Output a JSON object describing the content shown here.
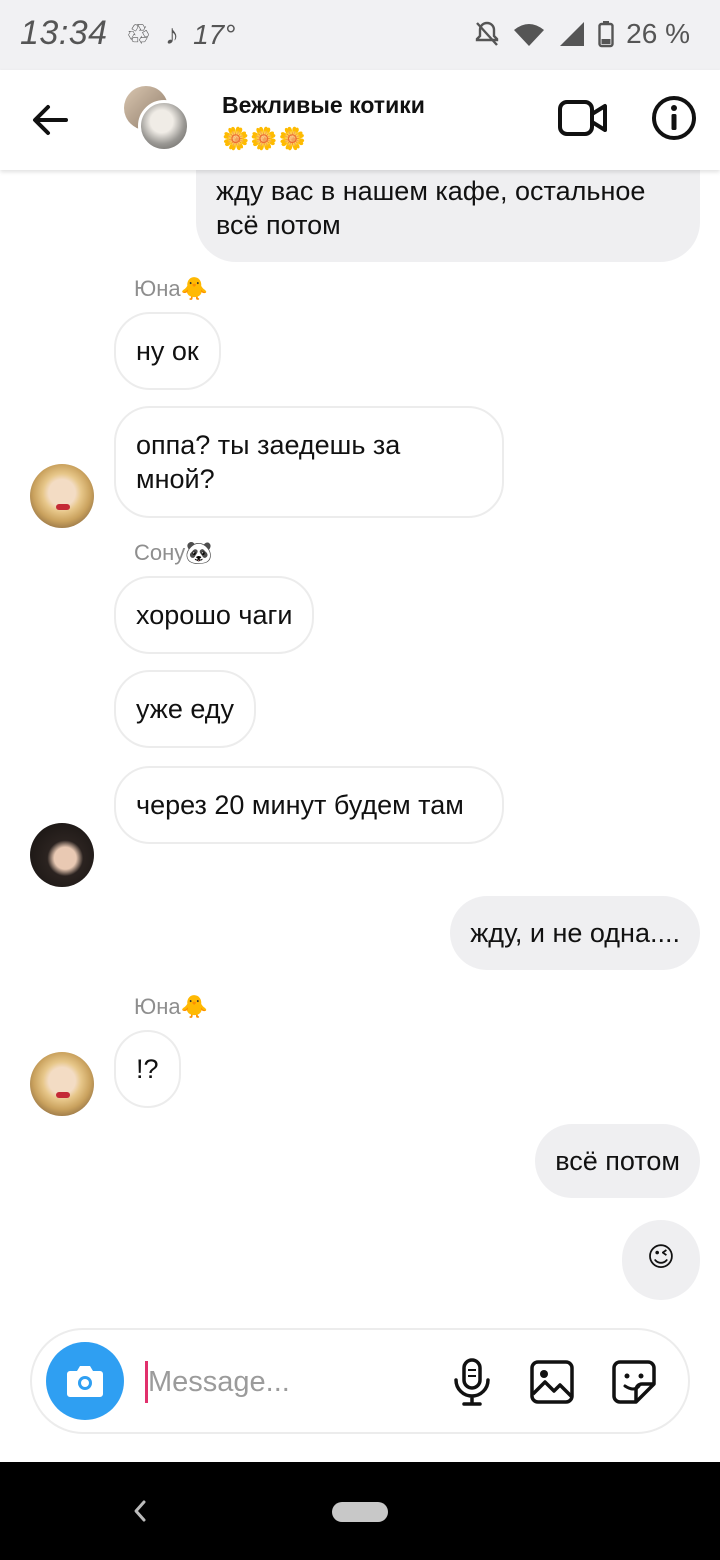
{
  "status_bar": {
    "time": "13:34",
    "temperature": "17°",
    "battery": "26 %"
  },
  "header": {
    "title": "Вежливые котики",
    "subtitle": "🌼🌼🌼"
  },
  "messages": {
    "m1": "жду вас в нашем кафе, остальное всё потом",
    "s1": "Юна🐥",
    "m2": "ну ок",
    "m3": "оппа? ты заедешь за мной?",
    "s2": "Сону🐼",
    "m4": "хорошо чаги",
    "m5": "уже еду",
    "m6": "через 20 минут будем там",
    "m7": "жду, и не одна....",
    "s3": "Юна🐥",
    "m8": "!?",
    "m9": "всё потом",
    "m10": "😉"
  },
  "composer": {
    "placeholder": "Message..."
  },
  "colors": {
    "accent": "#2f9ff2",
    "cursor": "#e1306c",
    "outgoing_bubble": "#efeff1"
  }
}
